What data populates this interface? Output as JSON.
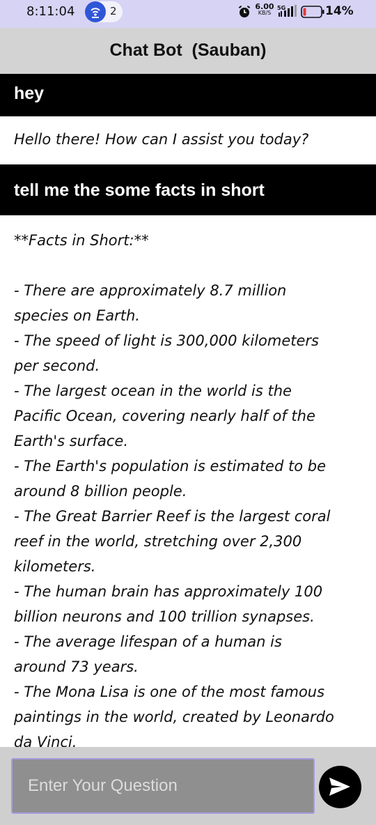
{
  "status_bar": {
    "time": "8:11:04",
    "hotspot_count": "2",
    "speed_value": "6.00",
    "speed_unit": "KB/S",
    "network": "5G",
    "battery": "14%",
    "icons": [
      "hotspot-icon",
      "alarm-icon",
      "signal-icon",
      "battery-icon"
    ]
  },
  "header": {
    "title": "Chat Bot  (Sauban)"
  },
  "messages": [
    {
      "role": "user",
      "text": "hey"
    },
    {
      "role": "bot",
      "lines": [
        "Hello there! How can I assist you today?"
      ]
    },
    {
      "role": "user",
      "text": "tell me the some facts in short"
    },
    {
      "role": "bot",
      "lines": [
        "**Facts in Short:**",
        "",
        "- There are approximately 8.7 million",
        "species on Earth.",
        "- The speed of light is 300,000 kilometers",
        "per second.",
        "- The largest ocean in the world is the",
        "Pacific Ocean, covering nearly half of the",
        "Earth's surface.",
        "- The Earth's population is estimated to be",
        "around 8 billion people.",
        "- The Great Barrier Reef is the largest coral",
        "reef in the world, stretching over 2,300",
        "kilometers.",
        "- The human brain has approximately 100",
        "billion neurons and 100 trillion synapses.",
        "- The average lifespan of a human is",
        "around 73 years.",
        "- The Mona Lisa is one of the most famous",
        "paintings in the world, created by Leonardo",
        "da Vinci."
      ]
    }
  ],
  "input": {
    "placeholder": "Enter Your Question",
    "value": ""
  },
  "send_button": {
    "icon": "send-icon"
  },
  "colors": {
    "status_bar_bg": "#d6d3f5",
    "header_bg": "#d3d3d3",
    "user_bubble_bg": "#000000",
    "input_bg": "#8f8f8f",
    "input_border": "#a79be0",
    "hotspot_accent": "#2f56d6",
    "battery_low": "#e53935"
  }
}
